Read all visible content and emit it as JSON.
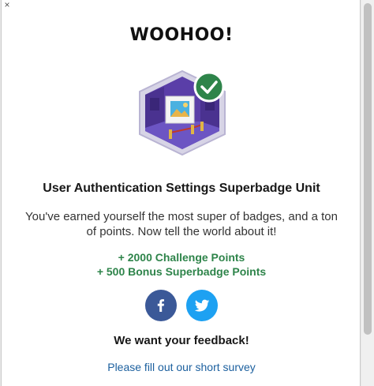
{
  "modal": {
    "close_glyph": "×",
    "title": "WOOHOO!",
    "badge_icon": "superbadge-gallery-icon",
    "unit_name": "User Authentication Settings Superbadge Unit",
    "message": "You've earned yourself the most super of badges, and a ton of points. Now tell the world about it!",
    "points": [
      "+ 2000 Challenge Points",
      "+ 500 Bonus Superbadge Points"
    ],
    "social": {
      "facebook_icon": "facebook-icon",
      "twitter_icon": "twitter-icon"
    },
    "feedback_heading": "We want your feedback!",
    "survey_link": "Please fill out our short survey"
  },
  "colors": {
    "points_green": "#2e844a",
    "facebook_blue": "#3b5998",
    "twitter_blue": "#1da1f2",
    "link_blue": "#1b5f9e",
    "check_green": "#2e844a",
    "badge_purple": "#5a3ea8"
  }
}
